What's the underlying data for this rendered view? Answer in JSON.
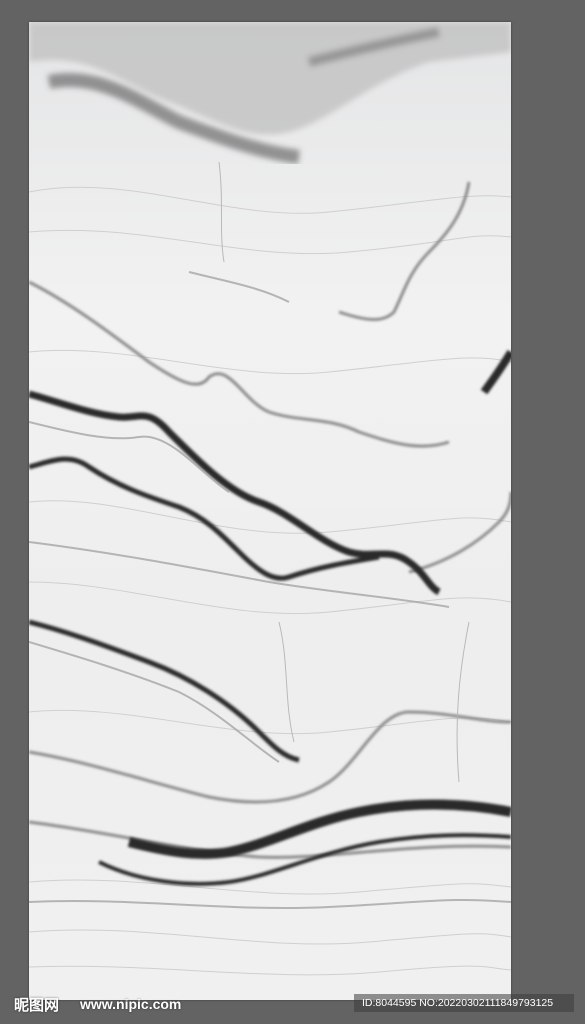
{
  "image": {
    "subject": "white marble slab with dark wavy veins",
    "background_color": "#636363",
    "slab_base_color": "#eceded",
    "vein_colors": [
      "#2a2a2a",
      "#555555",
      "#8c8c8c",
      "#b8b8b8"
    ]
  },
  "watermark": {
    "logo": "昵图网",
    "url": "www.nipic.com",
    "id_text": "ID:8044595 NO:20220302111849793125"
  }
}
